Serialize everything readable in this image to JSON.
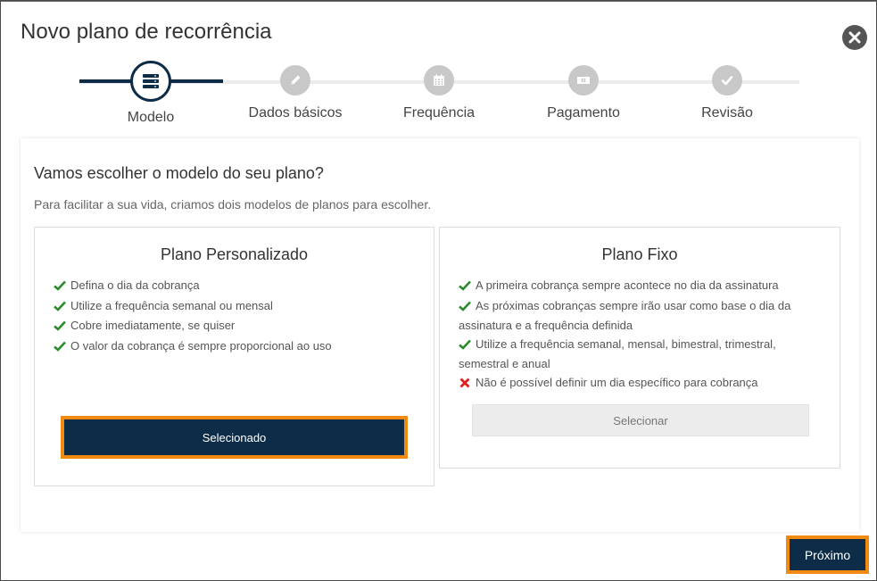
{
  "modal": {
    "title": "Novo plano de recorrência",
    "close_icon": "times-circle-icon"
  },
  "stepper": {
    "current_step": 1,
    "steps": [
      {
        "label": "Modelo",
        "icon": "server-icon",
        "state": "active"
      },
      {
        "label": "Dados básicos",
        "icon": "pencil-icon",
        "state": "pending"
      },
      {
        "label": "Frequência",
        "icon": "calendar-icon",
        "state": "pending"
      },
      {
        "label": "Pagamento",
        "icon": "money-icon",
        "state": "pending"
      },
      {
        "label": "Revisão",
        "icon": "check-icon",
        "state": "pending"
      }
    ]
  },
  "content": {
    "heading": "Vamos escolher o modelo do seu plano?",
    "subtext": "Para facilitar a sua vida, criamos dois modelos de planos para escolher."
  },
  "plans": [
    {
      "title": "Plano Personalizado",
      "features": [
        {
          "type": "check",
          "text": "Defina o dia da cobrança"
        },
        {
          "type": "check",
          "text": "Utilize a frequência semanal ou mensal"
        },
        {
          "type": "check",
          "text": "Cobre imediatamente, se quiser"
        },
        {
          "type": "check",
          "text": "O valor da cobrança é sempre proporcional ao uso"
        }
      ],
      "button_label": "Selecionado",
      "selected": true
    },
    {
      "title": "Plano Fixo",
      "features": [
        {
          "type": "check",
          "text": "A primeira cobrança sempre acontece no dia da assinatura"
        },
        {
          "type": "check",
          "text": "As próximas cobranças sempre irão usar como base o dia da assinatura e a frequência definida"
        },
        {
          "type": "check",
          "text": "Utilize a frequência semanal, mensal, bimestral, trimestral, semestral e anual"
        },
        {
          "type": "cross",
          "text": "Não é possível definir um dia específico para cobrança"
        }
      ],
      "button_label": "Selecionar",
      "selected": false
    }
  ],
  "footer": {
    "next_label": "Próximo"
  },
  "colors": {
    "primary": "#0c2c47",
    "highlight": "#f28a12",
    "check": "#2a8a2a",
    "cross": "#e02020",
    "inactive_step": "#c8c8c8"
  }
}
